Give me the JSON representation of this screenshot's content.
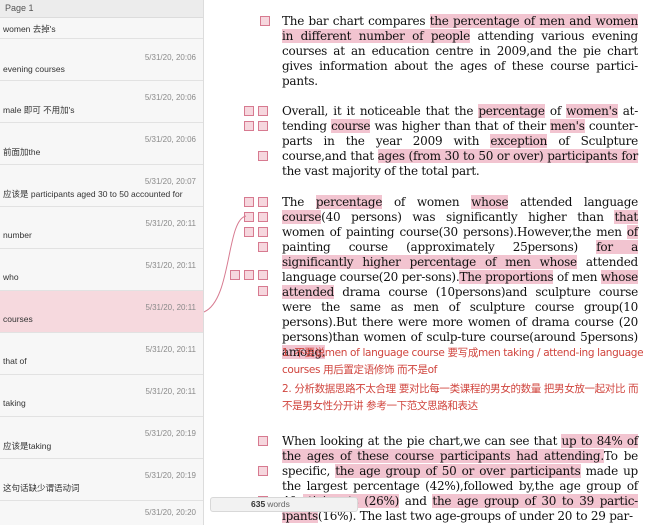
{
  "sidebar": {
    "header": "Page 1",
    "comments": [
      {
        "date": "",
        "text": "women 去掉's"
      },
      {
        "date": "5/31/20, 20:06",
        "text": "evening courses"
      },
      {
        "date": "5/31/20, 20:06",
        "text": "male 即可 不用加's"
      },
      {
        "date": "5/31/20, 20:06",
        "text": "前面加the"
      },
      {
        "date": "5/31/20, 20:07",
        "text": "应该是 participants aged 30 to 50 accounted for"
      },
      {
        "date": "5/31/20, 20:11",
        "text": "number"
      },
      {
        "date": "5/31/20, 20:11",
        "text": "who"
      },
      {
        "date": "5/31/20, 20:11",
        "text": "courses"
      },
      {
        "date": "5/31/20, 20:11",
        "text": "that of"
      },
      {
        "date": "5/31/20, 20:11",
        "text": "taking"
      },
      {
        "date": "5/31/20, 20:19",
        "text": "应该是taking"
      },
      {
        "date": "5/31/20, 20:19",
        "text": "这句话缺少谓语动词"
      },
      {
        "date": "5/31/20, 20:20",
        "text": ""
      }
    ]
  },
  "document": {
    "p1": {
      "a": "The bar chart compares ",
      "b": "the percentage of men and women in different number of people",
      "c": " attending various evening courses at an education centre in 2009,and the pie chart gives information about the ages of these course partici-pants."
    },
    "p2": {
      "a": "Overall, it it noticeable that the ",
      "b": "percentage",
      "c": " of ",
      "d": "women's",
      "e": " at-tending ",
      "f": "course",
      "g": " was higher than that of their ",
      "h": "men's",
      "i": " counter-parts in the year 2009 with ",
      "j": "exception",
      "k": " of Sculpture course,and that ",
      "l": "ages (from 30 to 50 or over) participants for",
      "m": " the vast majority of the total part."
    },
    "p3": {
      "a": "The ",
      "b": "percentage",
      "c": " of women ",
      "d": "whose",
      "e": " attended language ",
      "f": "course",
      "g": "(40 persons) was significantly higher than ",
      "h": "that",
      "i": " women of painting course(30 persons).However,the men ",
      "j": "of",
      "k": " painting course (approximately 25persons) ",
      "l": "for a significantly higher percentage of men whose",
      "m": " attended language course(20 per-sons).",
      "n": "The proportions",
      "o": " of men ",
      "p": "whose attended",
      "q": " drama course (10persons)and sculpture course were the same as men of sculpture course group(10 persons).But there were more women of drama course (20 persons)than women of sculp-ture course(around 5persons) ",
      "r": "among."
    },
    "notes": [
      {
        "num": "1.",
        "text": "不要说men of language course 要写成men taking / attend-ing language courses 用后置定语修饰 而不是of"
      },
      {
        "num": "2.",
        "text": "分析数据思路不太合理 要对比每一类课程的男女的数量 把男女放一起对比 而不是男女性分开讲 参考一下范文思路和表达"
      }
    ],
    "p4": {
      "a": "When looking at the pie chart,we can see that ",
      "b": "up to 84% of the ages of these course participants had attending.",
      "c": "To be specific, ",
      "d": "the age group of 50 or over participants",
      "e": " made up the largest percentage (42%),followed by,the age group of 40",
      "f": "rticipants (26%)",
      "g": " and ",
      "h": "the age group of 30 to 39 partic-ipants",
      "i": "(16%). The last two age-groups of under 20 to 29 par-"
    }
  },
  "status": {
    "word_count": "635",
    "word_label": "words"
  },
  "colors": {
    "highlight": "#f2c4d0",
    "note_red": "#d0453e",
    "active_comment": "#f6d9de",
    "marker_border": "#d77a90"
  }
}
